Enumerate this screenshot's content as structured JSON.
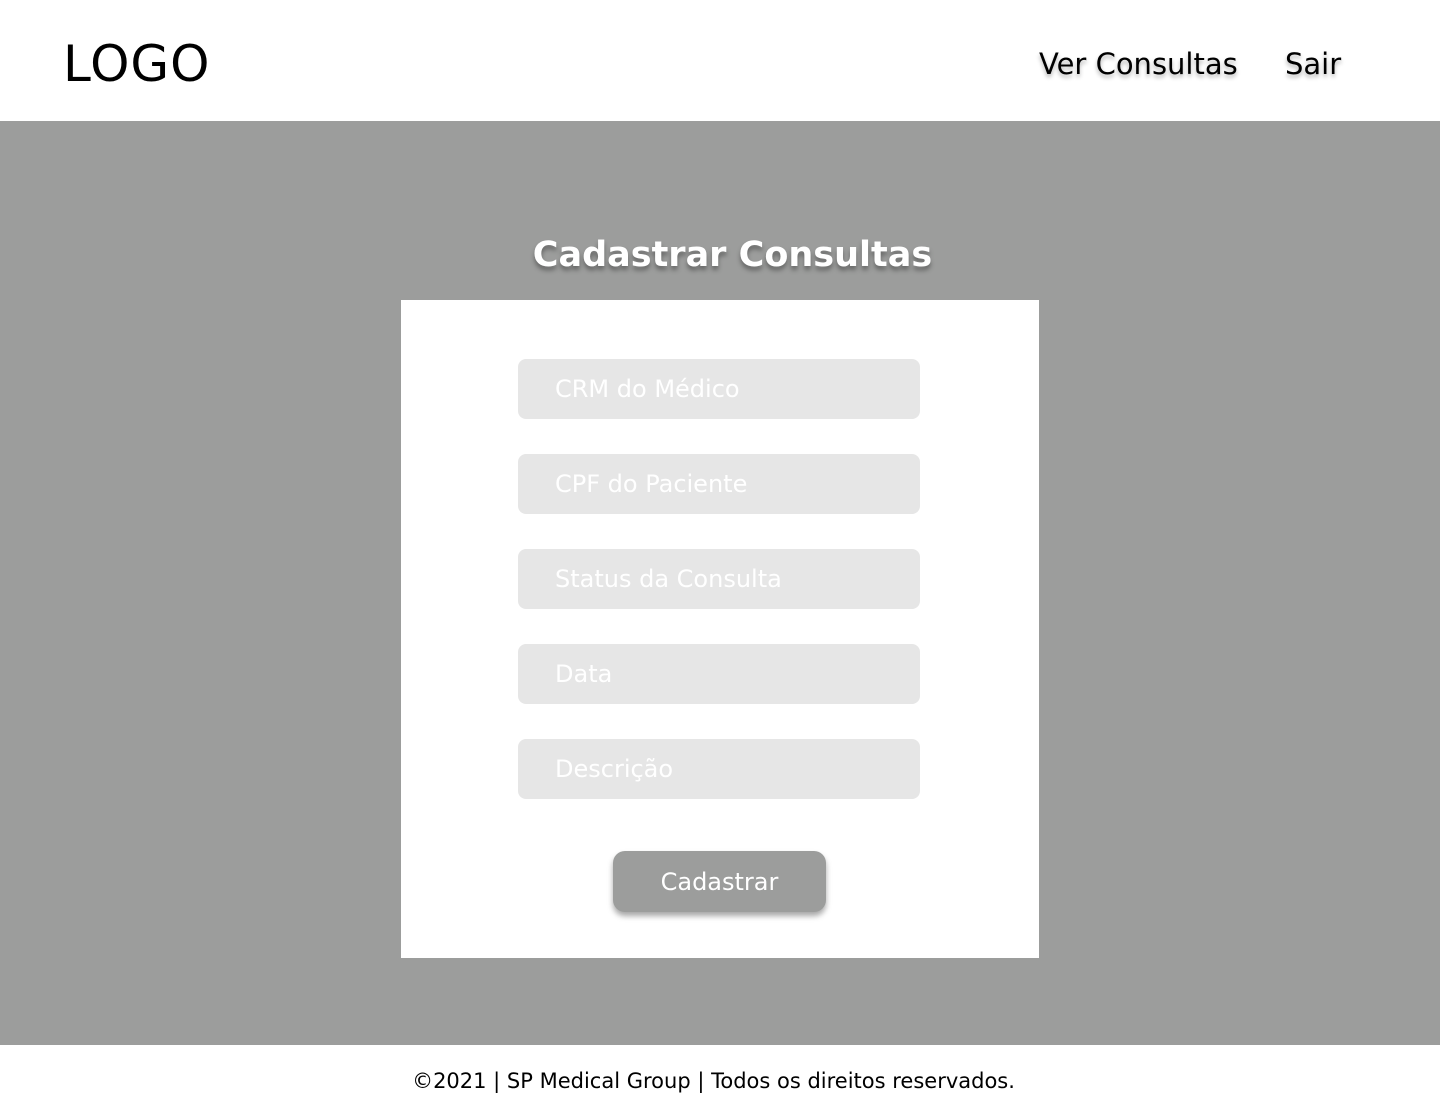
{
  "header": {
    "logo": "LOGO",
    "nav": [
      {
        "label": "Ver Consultas"
      },
      {
        "label": "Sair"
      }
    ]
  },
  "main": {
    "title": "Cadastrar Consultas",
    "form": {
      "fields": [
        {
          "placeholder": "CRM do Médico",
          "value": ""
        },
        {
          "placeholder": "CPF do Paciente",
          "value": ""
        },
        {
          "placeholder": "Status da Consulta",
          "value": ""
        },
        {
          "placeholder": "Data",
          "value": ""
        },
        {
          "placeholder": "Descrição",
          "value": ""
        }
      ],
      "submit_label": "Cadastrar"
    }
  },
  "footer": {
    "text": "©2021 | SP Medical Group | Todos os direitos reservados."
  },
  "colors": {
    "background_gray": "#9c9d9c",
    "input_gray": "#e6e6e6",
    "white": "#ffffff",
    "text_dark": "#000000"
  }
}
